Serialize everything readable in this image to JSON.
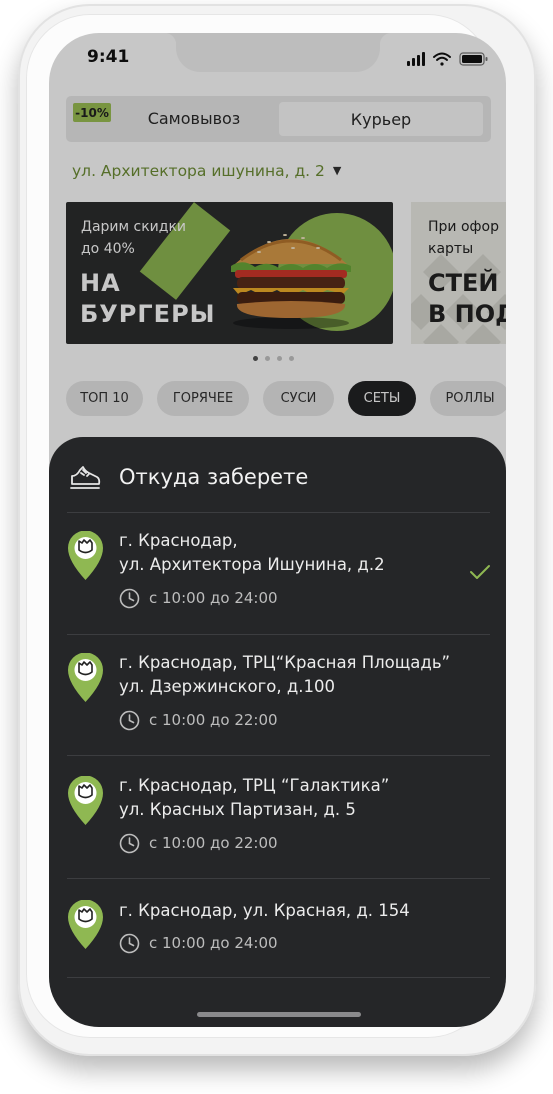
{
  "status_bar": {
    "time": "9:41"
  },
  "mode_toggle": {
    "badge": "-10%",
    "pickup_label": "Самовывоз",
    "courier_label": "Курьер"
  },
  "address": {
    "label": "ул. Архитектора ишунина, д. 2"
  },
  "banners": [
    {
      "small_lines": [
        "Дарим скидки",
        "до 40%"
      ],
      "big_lines": [
        "НА",
        "БУРГЕРЫ"
      ]
    },
    {
      "small_lines": [
        "При офор",
        "карты"
      ],
      "big_lines": [
        "СТЕЙ",
        "В ПОД"
      ]
    }
  ],
  "pager": {
    "count": 4,
    "active": 0
  },
  "categories": [
    {
      "label": "ТОП 10",
      "active": false
    },
    {
      "label": "ГОРЯЧЕЕ",
      "active": false
    },
    {
      "label": "СУСИ",
      "active": false
    },
    {
      "label": "СЕТЫ",
      "active": true
    },
    {
      "label": "РОЛЛЫ",
      "active": false
    }
  ],
  "sheet": {
    "title": "Откуда заберете",
    "locations": [
      {
        "lines": [
          "г. Краснодар,",
          "ул. Архитектора Ишунина, д.2"
        ],
        "hours": "с 10:00 до 24:00",
        "selected": true
      },
      {
        "lines": [
          "г. Краснодар, ТРЦ“Красная Площадь”",
          "ул. Дзержинского, д.100"
        ],
        "hours": "с 10:00 до 22:00",
        "selected": false
      },
      {
        "lines": [
          "г. Краснодар, ТРЦ “Галактика”",
          "ул. Красных Партизан, д. 5"
        ],
        "hours": "с 10:00 до 22:00",
        "selected": false
      },
      {
        "lines": [
          "г. Краснодар, ул. Красная, д. 154"
        ],
        "hours": "с 10:00 до 24:00",
        "selected": false
      }
    ]
  },
  "colors": {
    "accent": "#8fb852",
    "sheet": "#252628",
    "address": "#6f8f36"
  },
  "icons": [
    "signal-icon",
    "wifi-icon",
    "battery-icon",
    "caret-down-icon",
    "burger-image",
    "sneaker-icon",
    "map-pin-icon",
    "clock-icon",
    "check-icon"
  ]
}
